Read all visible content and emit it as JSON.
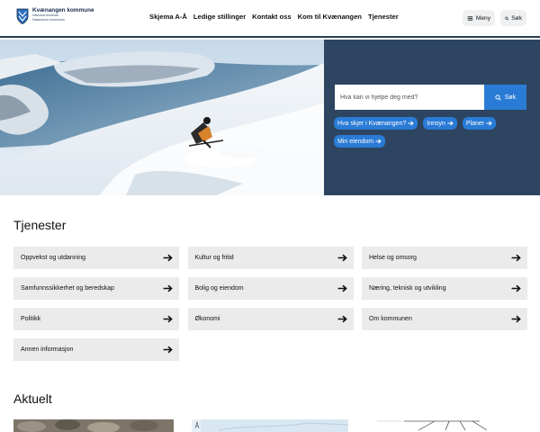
{
  "header": {
    "logo": {
      "name": "Kvænangen kommune",
      "sub_1": "Návuona suohkan",
      "sub_2": "Naavuonon kommuuni"
    },
    "nav": [
      {
        "label": "Skjema A-Å"
      },
      {
        "label": "Ledige stillinger"
      },
      {
        "label": "Kontakt oss"
      },
      {
        "label": "Kom til Kvænangen"
      },
      {
        "label": "Tjenester"
      }
    ],
    "menu_label": "Meny",
    "search_label": "Søk"
  },
  "hero": {
    "search": {
      "placeholder": "Hva kan vi hjelpe deg med?",
      "button_label": "Søk"
    },
    "chips": [
      {
        "label": "Hva skjer i Kvænangen?"
      },
      {
        "label": "Innsyn"
      },
      {
        "label": "Planer"
      },
      {
        "label": "Min eiendom"
      }
    ]
  },
  "services": {
    "title": "Tjenester",
    "items": [
      {
        "label": "Oppvekst og utdanning"
      },
      {
        "label": "Kultur og fritid"
      },
      {
        "label": "Helse og omsorg"
      },
      {
        "label": "Samfunnssikkerhet og beredskap"
      },
      {
        "label": "Bolig og eiendom"
      },
      {
        "label": "Næring, teknisk og utvikling"
      },
      {
        "label": "Politikk"
      },
      {
        "label": "Økonomi"
      },
      {
        "label": "Om kommunen"
      },
      {
        "label": "Annen informasjon"
      }
    ]
  },
  "news": {
    "title": "Aktuelt"
  },
  "colors": {
    "accent": "#2a7bd5",
    "hero_panel": "#2d4560",
    "tile_bg": "#ebebeb"
  }
}
